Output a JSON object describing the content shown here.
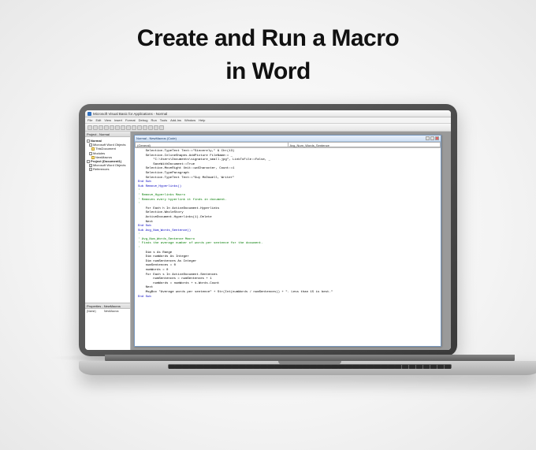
{
  "headline_line1": "Create and Run a Macro",
  "headline_line2": "in Word",
  "vba": {
    "title": "Microsoft Visual Basic for Applications - Normal",
    "menu": [
      "File",
      "Edit",
      "View",
      "Insert",
      "Format",
      "Debug",
      "Run",
      "Tools",
      "Add-Ins",
      "Window",
      "Help"
    ],
    "project_head": "Project - Normal",
    "tree": {
      "normal": "Normal",
      "word_objects": "Microsoft Word Objects",
      "this_doc": "ThisDocument",
      "modules": "Modules",
      "module1": "NewMacros",
      "project2": "Project (Document1)",
      "word_objects2": "Microsoft Word Objects",
      "references": "References"
    },
    "props_head": "Properties - NewMacros",
    "props_name_label": "(Name)",
    "props_name_value": "NewMacros",
    "code_window_title": "Normal - NewMacros (Code)",
    "dropdown_left": "(General)",
    "dropdown_right": "Avg_Num_Words_Sentence",
    "code_lines": [
      {
        "t": "    Selection.TypeText Text:=\"Sincerely,\" & Chr(13)",
        "c": "plain"
      },
      {
        "t": "    Selection.InlineShapes.AddPicture FileName:= _",
        "c": "plain"
      },
      {
        "t": "        \"C:\\Users\\Documents\\signature_small.jpg\", LinkToFile:=False, _",
        "c": "plain"
      },
      {
        "t": "        SaveWithDocument:=True",
        "c": "plain"
      },
      {
        "t": "    Selection.MoveRight Unit:=wdCharacter, Count:=1",
        "c": "plain"
      },
      {
        "t": "    Selection.TypeParagraph",
        "c": "plain"
      },
      {
        "t": "    Selection.TypeText Text:=\"Guy McDowell, Writer\"",
        "c": "plain"
      },
      {
        "t": "End Sub",
        "c": "kw"
      },
      {
        "t": "Sub Remove_Hyperlinks()",
        "c": "kw"
      },
      {
        "t": "'",
        "c": "cm"
      },
      {
        "t": "' Remove_Hyperlinks Macro",
        "c": "cm"
      },
      {
        "t": "' Removes every hyperlink it finds in document.",
        "c": "cm"
      },
      {
        "t": "'",
        "c": "cm"
      },
      {
        "t": "    For Each h In ActiveDocument.Hyperlinks",
        "c": "plain"
      },
      {
        "t": "    Selection.WholeStory",
        "c": "plain"
      },
      {
        "t": "    ActiveDocument.Hyperlinks(1).Delete",
        "c": "plain"
      },
      {
        "t": "    Next",
        "c": "plain"
      },
      {
        "t": "End Sub",
        "c": "kw"
      },
      {
        "t": "Sub Avg_Num_Words_Sentence()",
        "c": "kw"
      },
      {
        "t": "'",
        "c": "cm"
      },
      {
        "t": "' Avg_Num_Words_Sentence Macro",
        "c": "cm"
      },
      {
        "t": "' Finds the average number of words per sentence for the document.",
        "c": "cm"
      },
      {
        "t": "'",
        "c": "cm"
      },
      {
        "t": "",
        "c": "plain"
      },
      {
        "t": "    Dim s As Range",
        "c": "plain"
      },
      {
        "t": "    Dim numWords As Integer",
        "c": "plain"
      },
      {
        "t": "    Dim numSentences As Integer",
        "c": "plain"
      },
      {
        "t": "    numSentences = 0",
        "c": "plain"
      },
      {
        "t": "    numWords = 0",
        "c": "plain"
      },
      {
        "t": "    For Each s In ActiveDocument.Sentences",
        "c": "plain"
      },
      {
        "t": "        numSentences = numSentences + 1",
        "c": "plain"
      },
      {
        "t": "        numWords = numWords + s.Words.Count",
        "c": "plain"
      },
      {
        "t": "    Next",
        "c": "plain"
      },
      {
        "t": "    MsgBox \"Average words per sentence\" + Str(Int(numWords / numSentences)) + \". Less than 15 is best.\"",
        "c": "plain"
      },
      {
        "t": "End Sub",
        "c": "kw"
      }
    ]
  }
}
